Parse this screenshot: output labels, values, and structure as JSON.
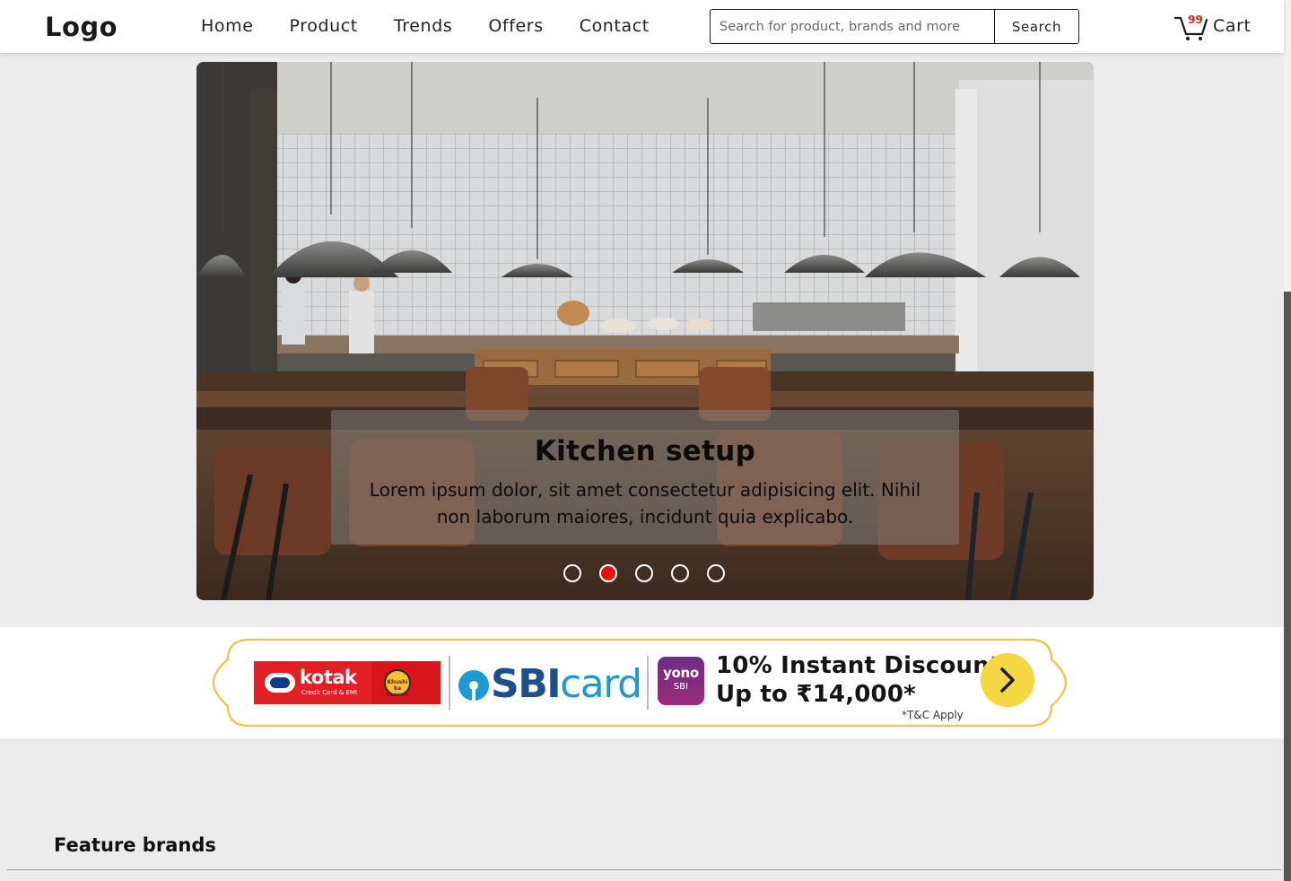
{
  "header": {
    "logo": "Logo",
    "nav": [
      "Home",
      "Product",
      "Trends",
      "Offers",
      "Contact"
    ],
    "search": {
      "placeholder": "Search for product, brands and more",
      "button": "Search"
    },
    "cart": {
      "count": "99",
      "label": "Cart",
      "badge_color": "#e81d1d"
    }
  },
  "hero": {
    "caption_title": "Kitchen setup",
    "caption_text": "Lorem ipsum dolor, sit amet consectetur adipisicing elit. Nihil non laborum maiores, incidunt quia explicabo.",
    "slide_count": 5,
    "active_slide": 2,
    "active_dot_color": "#e41010"
  },
  "offer_banner": {
    "kotak_name": "kotak",
    "kotak_sub": "Credit Card & EMI",
    "kotak_seal": "Khushi ka season",
    "sbi_part1": "SBI",
    "sbi_part2": "card",
    "yono_top": "yono",
    "yono_bottom": "SBI",
    "line1": "10% Instant Discount",
    "line2": "Up to ₹14,000*",
    "terms": "*T&C Apply",
    "accent_color": "#f5d742"
  },
  "featured": {
    "title": "Feature brands"
  }
}
